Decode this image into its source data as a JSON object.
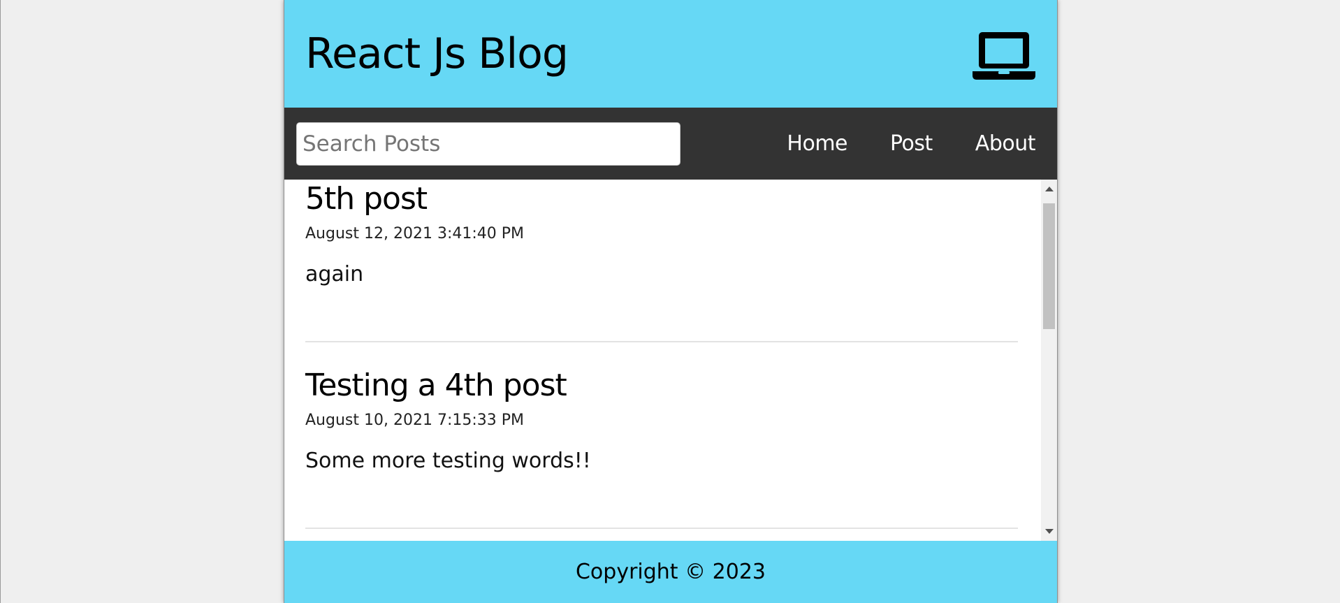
{
  "header": {
    "title": "React Js Blog",
    "icon": "laptop-icon"
  },
  "nav": {
    "search": {
      "placeholder": "Search Posts",
      "value": ""
    },
    "links": [
      {
        "label": "Home"
      },
      {
        "label": "Post"
      },
      {
        "label": "About"
      }
    ]
  },
  "posts": [
    {
      "title": "5th post",
      "datetime": "August 12, 2021 3:41:40 PM",
      "body": "again"
    },
    {
      "title": "Testing a 4th post",
      "datetime": "August 10, 2021 7:15:33 PM",
      "body": "Some more testing words!!"
    }
  ],
  "footer": {
    "copyright": "Copyright © 2023"
  },
  "colors": {
    "header_bg": "#66d8f5",
    "nav_bg": "#333333",
    "footer_bg": "#66d8f5"
  }
}
